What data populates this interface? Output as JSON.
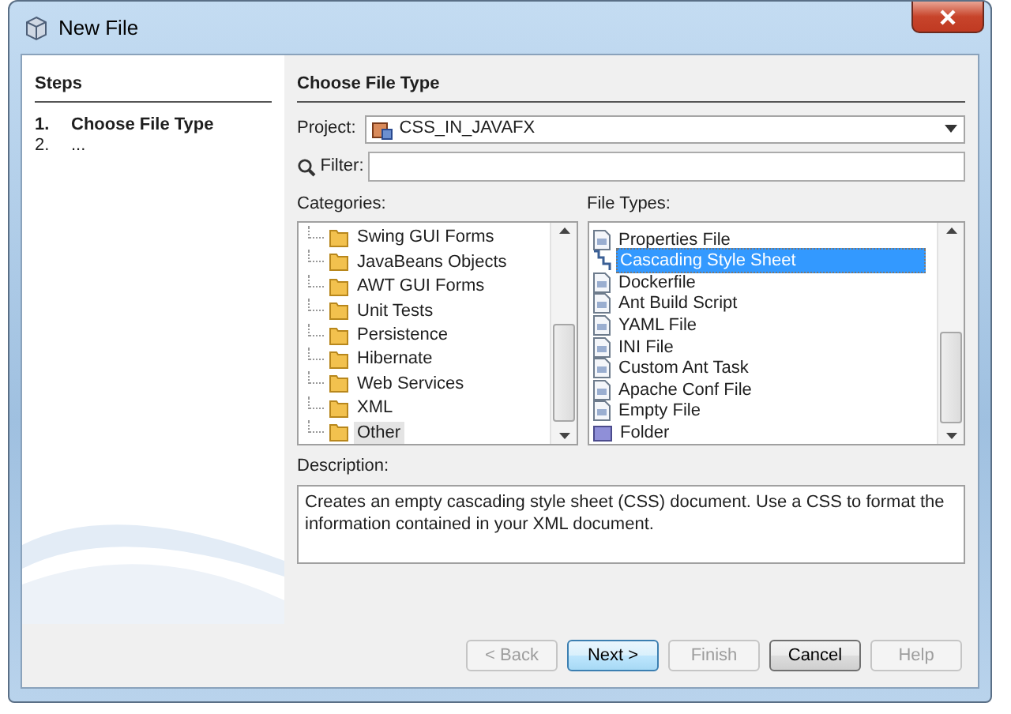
{
  "window": {
    "title": "New File"
  },
  "steps": {
    "heading": "Steps",
    "items": [
      {
        "number": "1.",
        "label": "Choose File Type",
        "selected": true
      },
      {
        "number": "2.",
        "label": "...",
        "selected": false
      }
    ]
  },
  "panel": {
    "heading": "Choose File Type",
    "project": {
      "label": "Project:",
      "value": "CSS_IN_JAVAFX"
    },
    "filter": {
      "label": "Filter:"
    },
    "categories": {
      "label": "Categories:",
      "items": [
        {
          "label": "Swing GUI Forms",
          "selected": false
        },
        {
          "label": "JavaBeans Objects",
          "selected": false
        },
        {
          "label": "AWT GUI Forms",
          "selected": false
        },
        {
          "label": "Unit Tests",
          "selected": false
        },
        {
          "label": "Persistence",
          "selected": false
        },
        {
          "label": "Hibernate",
          "selected": false
        },
        {
          "label": "Web Services",
          "selected": false
        },
        {
          "label": "XML",
          "selected": false
        },
        {
          "label": "Other",
          "selected": true
        }
      ]
    },
    "file_types": {
      "label": "File Types:",
      "items": [
        {
          "label": "Properties File",
          "kind": "file",
          "selected": false
        },
        {
          "label": "Cascading Style Sheet",
          "kind": "style",
          "selected": true
        },
        {
          "label": "Dockerfile",
          "kind": "file",
          "selected": false
        },
        {
          "label": "Ant Build Script",
          "kind": "file",
          "selected": false
        },
        {
          "label": "YAML File",
          "kind": "file",
          "selected": false
        },
        {
          "label": "INI File",
          "kind": "file",
          "selected": false
        },
        {
          "label": "Custom Ant Task",
          "kind": "file",
          "selected": false
        },
        {
          "label": "Apache Conf File",
          "kind": "file",
          "selected": false
        },
        {
          "label": "Empty File",
          "kind": "file",
          "selected": false
        },
        {
          "label": "Folder",
          "kind": "folder",
          "selected": false
        }
      ]
    },
    "description": {
      "label": "Description:",
      "text": "Creates an empty cascading style sheet (CSS) document. Use a CSS to format the information contained in your XML document."
    }
  },
  "buttons": [
    {
      "label": "< Back",
      "disabled": true,
      "default": false
    },
    {
      "label": "Next >",
      "disabled": false,
      "default": true
    },
    {
      "label": "Finish",
      "disabled": true,
      "default": false
    },
    {
      "label": "Cancel",
      "disabled": false,
      "default": false
    },
    {
      "label": "Help",
      "disabled": true,
      "default": false
    }
  ]
}
